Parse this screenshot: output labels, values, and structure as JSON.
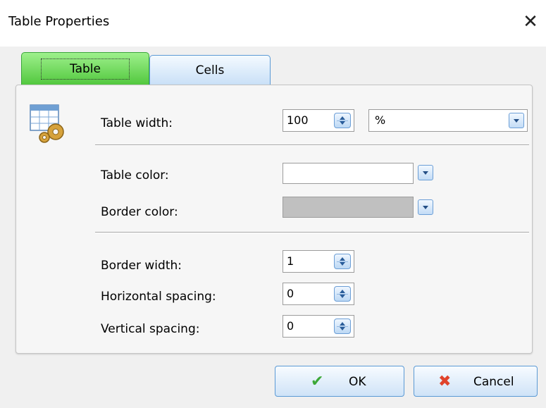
{
  "window": {
    "title": "Table Properties",
    "close_symbol": "✕"
  },
  "tabs": [
    {
      "label": "Table"
    },
    {
      "label": "Cells"
    }
  ],
  "table": {
    "width_label": "Table width:",
    "width_value": "100",
    "width_unit": "%",
    "color_label": "Table color:",
    "color_value": "#ffffff",
    "border_color_label": "Border color:",
    "border_color_value": "#c0c0c0",
    "border_width_label": "Border width:",
    "border_width_value": "1",
    "h_spacing_label": "Horizontal spacing:",
    "h_spacing_value": "0",
    "v_spacing_label": "Vertical spacing:",
    "v_spacing_value": "0"
  },
  "buttons": {
    "ok_label": "OK",
    "cancel_label": "Cancel"
  },
  "icons": {
    "table_properties": "table-gear-icon",
    "ok": "checkmark-icon",
    "cancel": "x-icon"
  }
}
